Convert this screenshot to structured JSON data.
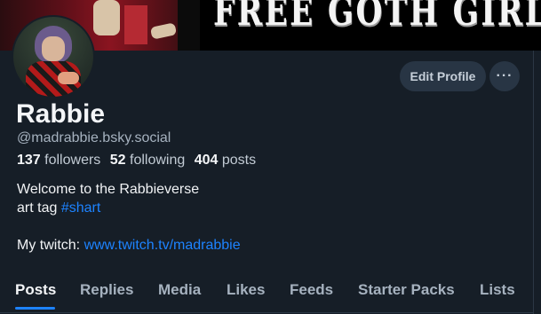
{
  "banner": {
    "text": "FREE GOTH GIRLS"
  },
  "profile": {
    "display_name": "Rabbie",
    "handle": "@madrabbie.bsky.social",
    "followers_count": "137",
    "followers_label": "followers",
    "following_count": "52",
    "following_label": "following",
    "posts_count": "404",
    "posts_label": "posts",
    "bio": {
      "line1": "Welcome to the Rabbieverse",
      "line2_prefix": "art tag ",
      "hashtag": "#shart",
      "twitch_prefix": "My twitch: ",
      "twitch_link": "www.twitch.tv/madrabbie"
    }
  },
  "actions": {
    "edit_profile": "Edit Profile",
    "more": "···"
  },
  "tabs": [
    {
      "label": "Posts",
      "active": true
    },
    {
      "label": "Replies",
      "active": false
    },
    {
      "label": "Media",
      "active": false
    },
    {
      "label": "Likes",
      "active": false
    },
    {
      "label": "Feeds",
      "active": false
    },
    {
      "label": "Starter Packs",
      "active": false
    },
    {
      "label": "Lists",
      "active": false
    }
  ],
  "colors": {
    "background": "#161e27",
    "accent": "#1d83ff",
    "muted": "#a6b2bf",
    "button_bg": "#283544"
  }
}
